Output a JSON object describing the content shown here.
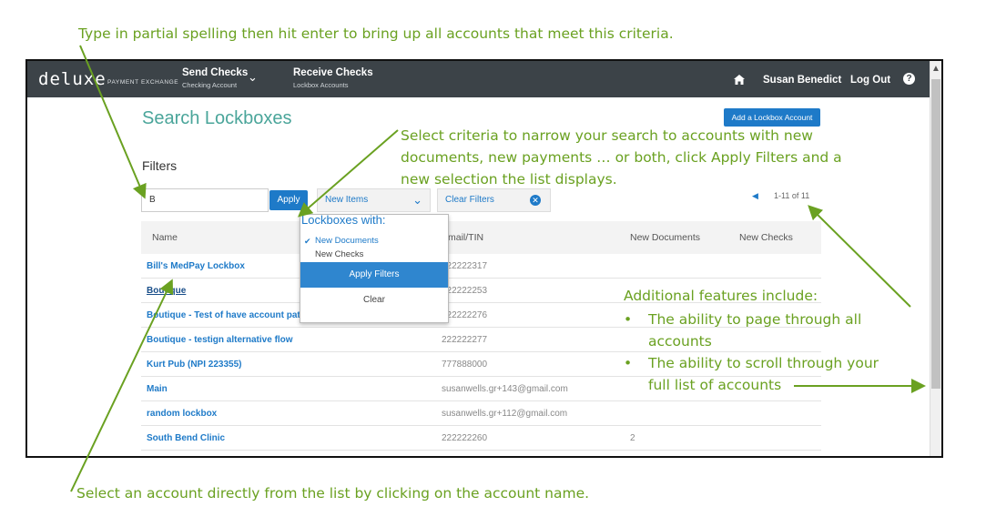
{
  "annotations": {
    "top": "Type in partial spelling then hit enter to bring up all accounts that meet this criteria.",
    "criteria": [
      "Select criteria to narrow your search to accounts with new",
      "documents, new payments … or both, click Apply Filters and a",
      "new selection the list displays."
    ],
    "features_title": "Additional features include:",
    "features": [
      [
        "The ability to page through all",
        "accounts"
      ],
      [
        "The ability to scroll through your",
        "full list of accounts"
      ]
    ],
    "bottom": "Select an account directly from the list by clicking on the account name."
  },
  "header": {
    "brand": "deluxe",
    "brand_sub": "PAYMENT EXCHANGE",
    "send_checks": "Send Checks",
    "send_checks_sub": "Checking Account",
    "receive_checks": "Receive Checks",
    "receive_checks_sub": "Lockbox Accounts",
    "user": "Susan Benedict",
    "logout": "Log Out",
    "home_icon": "home-icon",
    "help_icon": "help-icon"
  },
  "page": {
    "title": "Search Lockboxes",
    "add_button": "Add a Lockbox Account",
    "filters_heading": "Filters",
    "search_value": "B",
    "apply": "Apply",
    "new_items": "New Items",
    "clear_filters": "Clear Filters",
    "pager": "1-11 of 11"
  },
  "popup": {
    "heading": "Lockboxes with:",
    "option1": "New Documents",
    "option1_checked": true,
    "option2": "New Checks",
    "option2_checked": false,
    "apply": "Apply Filters",
    "clear": "Clear"
  },
  "table": {
    "headers": [
      "Name",
      "Email/TIN",
      "New Documents",
      "New Checks"
    ],
    "rows": [
      {
        "name": "Bill's MedPay Lockbox",
        "email": "222222317",
        "docs": ""
      },
      {
        "name": "Boutique",
        "email": "222222253",
        "docs": ""
      },
      {
        "name": "Boutique - Test of have account path",
        "email": "222222276",
        "docs": ""
      },
      {
        "name": "Boutique - testign alternative flow",
        "email": "222222277",
        "docs": ""
      },
      {
        "name": "Kurt Pub (NPI 223355)",
        "email": "777888000",
        "docs": ""
      },
      {
        "name": "Main",
        "email": "susanwells.gr+143@gmail.com",
        "docs": ""
      },
      {
        "name": "random lockbox",
        "email": "susanwells.gr+112@gmail.com",
        "docs": ""
      },
      {
        "name": "South Bend Clinic",
        "email": "222222260",
        "docs": "2"
      }
    ]
  },
  "colors": {
    "annotation_green": "#6aa121",
    "accent_blue": "#1e7ac8",
    "header_bg": "#3c4348",
    "title_teal": "#4aa59a"
  }
}
